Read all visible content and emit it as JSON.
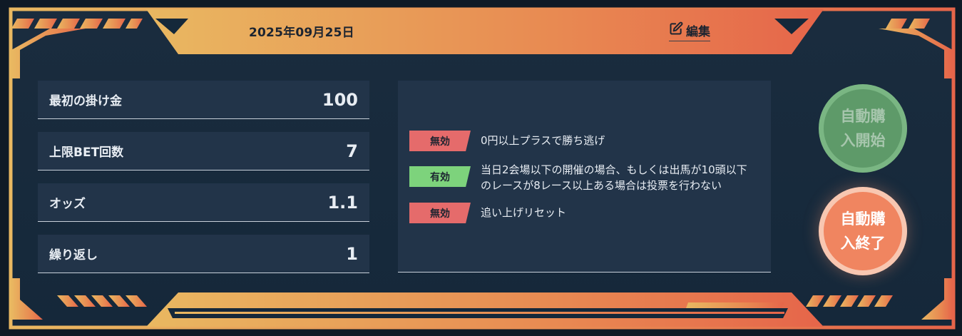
{
  "header": {
    "date": "2025年09月25日",
    "edit_label": "編集"
  },
  "stats": [
    {
      "label": "最初の掛け金",
      "value": "100"
    },
    {
      "label": "上限BET回数",
      "value": "7"
    },
    {
      "label": "オッズ",
      "value": "1.1"
    },
    {
      "label": "繰り返し",
      "value": "1"
    }
  ],
  "rules": [
    {
      "status": "無効",
      "text": "0円以上プラスで勝ち逃げ"
    },
    {
      "status": "有効",
      "text": "当日2会場以下の開催の場合、もしくは出馬が10頭以下のレースが8レース以上ある場合は投票を行わない"
    },
    {
      "status": "無効",
      "text": "追い上げリセット"
    }
  ],
  "buttons": {
    "start_label": "自動購入開始",
    "stop_label": "自動購入終了"
  },
  "colors": {
    "accent_gradient_start": "#e8b55e",
    "accent_gradient_end": "#e86a45",
    "panel": "#223449",
    "enabled": "#7dd37c",
    "disabled": "#e56b6b",
    "start_button": "#5e9a69",
    "stop_button": "#f08560"
  },
  "icons": {
    "edit": "pencil-square-icon"
  }
}
